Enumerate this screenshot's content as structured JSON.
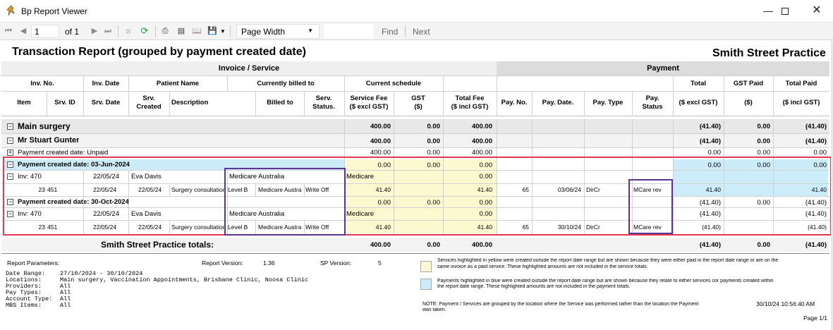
{
  "window": {
    "title": "Bp Report Viewer"
  },
  "toolbar": {
    "page_current": "1",
    "page_of": "of 1",
    "zoom": "Page Width",
    "find_label": "Find",
    "next_label": "Next"
  },
  "report": {
    "title": "Transaction Report (grouped by payment created date)",
    "practice": "Smith Street Practice",
    "group_headers": {
      "invoice_service": "Invoice / Service",
      "payment": "Payment"
    },
    "header_row1": {
      "inv_no": "Inv. No.",
      "inv_date": "Inv. Date",
      "patient_name": "Patient Name",
      "currently_billed_to": "Currently billed to",
      "current_schedule": "Current schedule",
      "total": "Total",
      "gst_paid": "GST Paid",
      "total_paid": "Total Paid"
    },
    "header_row2": {
      "item": "Item",
      "srv_id": "Srv. ID",
      "srv_date": "Srv. Date",
      "srv_created_1": "Srv.",
      "srv_created_2": "Created",
      "description": "Description",
      "billed_to": "Billed to",
      "serv_status_1": "Serv.",
      "serv_status_2": "Status.",
      "service_fee_1": "Service Fee",
      "service_fee_2": "($ excl GST)",
      "gst_1": "GST",
      "gst_2": "($)",
      "total_fee_1": "Total Fee",
      "total_fee_2": "($ incl GST)",
      "pay_no": "Pay. No.",
      "pay_date": "Pay. Date.",
      "pay_type": "Pay. Type",
      "pay_status_1": "Pay.",
      "pay_status_2": "Status",
      "total_excl": "($ excl GST)",
      "gst_paid_unit": "($)",
      "total_incl": "($ incl GST)"
    },
    "main_surgery": {
      "label": "Main surgery",
      "fee": "400.00",
      "gst": "0.00",
      "total": "400.00",
      "pay_total": "(41.40)",
      "pay_gst": "0.00",
      "pay_total_paid": "(41.40)"
    },
    "patient": {
      "label": "Mr Stuart Gunter",
      "fee": "400.00",
      "gst": "0.00",
      "total": "400.00",
      "pay_total": "(41.40)",
      "pay_gst": "0.00",
      "pay_total_paid": "(41.40)"
    },
    "unpaid": {
      "label": "Payment created date: Unpaid",
      "fee": "400.00",
      "gst": "0.00",
      "total": "400.00",
      "pay_total": "0.00",
      "pay_gst": "0.00",
      "pay_total_paid": "0.00"
    },
    "group1": {
      "label": "Payment created date: 03-Jun-2024",
      "fee": "0.00",
      "gst": "0.00",
      "total": "0.00",
      "pay_total": "0.00",
      "pay_gst": "0.00",
      "pay_total_paid": "0.00",
      "inv": {
        "label": "Inv: 470",
        "date": "22/05/24",
        "patient": "Eva Davis",
        "billed": "Medicare Australia",
        "schedule": "Medicare",
        "total": "0.00"
      },
      "row": {
        "item": "23",
        "srv_id": "451",
        "srv_date": "22/05/24",
        "created": "22/05/24",
        "desc": "Surgery consultation",
        "level": "Level B",
        "billed_to": "Medicare Austra",
        "status": "Write Off",
        "fee": "41.40",
        "total": "41.40",
        "pay_no": "65",
        "pay_date": "03/06/24",
        "pay_type": "DirCr",
        "pay_status": "MCare rev",
        "pay_total": "41.40",
        "pay_total_paid": "41.40"
      }
    },
    "group2": {
      "label": "Payment created date: 30-Oct-2024",
      "fee": "0.00",
      "gst": "0.00",
      "total": "0.00",
      "pay_total": "(41.40)",
      "pay_gst": "0.00",
      "pay_total_paid": "(41.40)",
      "inv": {
        "label": "Inv: 470",
        "date": "22/05/24",
        "patient": "Eva Davis",
        "billed": "Medicare Australia",
        "schedule": "Medicare",
        "total": "0.00",
        "pay_total": "(41.40)",
        "pay_total_paid": "(41.40)"
      },
      "row": {
        "item": "23",
        "srv_id": "451",
        "srv_date": "22/05/24",
        "created": "22/05/24",
        "desc": "Surgery consultation",
        "level": "Level B",
        "billed_to": "Medicare Austra",
        "status": "Write Off",
        "fee": "41.40",
        "total": "41.40",
        "pay_no": "65",
        "pay_date": "30/10/24",
        "pay_type": "DirCr",
        "pay_status": "MCare rev",
        "pay_total": "(41.40)",
        "pay_total_paid": "(41.40)"
      }
    },
    "totals": {
      "label": "Smith Street Practice totals:",
      "fee": "400.00",
      "gst": "0.00",
      "total": "400.00",
      "pay_total": "(41.40)",
      "pay_gst": "0.00",
      "pay_total_paid": "(41.40)"
    },
    "footer": {
      "params_label": "Report Parameters:",
      "version_label": "Report Version:",
      "version": "1.36",
      "sp_label": "SP Version:",
      "sp": "5",
      "params": [
        {
          "k": "Date Range:",
          "v": "27/10/2024 - 30/10/2024"
        },
        {
          "k": "Locations:",
          "v": "Main surgery, Vaccination Appointments, Brisbane Clinic, Noosa Clinic"
        },
        {
          "k": "Providers:",
          "v": "All"
        },
        {
          "k": "Pay Types:",
          "v": "All"
        },
        {
          "k": "Account Type:",
          "v": "All"
        },
        {
          "k": "MBS Items:",
          "v": "All"
        }
      ],
      "legend_yellow_1": "Services highlighted in yellow were created outside the report date range but are shown because they were either paid in the report date range or are on the",
      "legend_yellow_2": "same invoice as a paid service.  These highlighted amounts are not included in the service totals.",
      "legend_blue_1": "Payments highlighted in blue were created outside the report date range but are shown because they relate to either services cor payments created within",
      "legend_blue_2": "the report date range. These highlighted amounts are not included in the payment totals.",
      "note_1": "NOTE:  Payment / Services are grouped by the location where the Service was performed rather than the location the Payment",
      "note_2": "was taken.",
      "timestamp": "30/10/24 10:56:40 AM",
      "page": "Page 1/1"
    }
  },
  "colors": {
    "highlight_red": "#e23a55",
    "highlight_purple": "#5b3393",
    "yellow": "#fdf8cf",
    "blue": "#cbecf8"
  }
}
